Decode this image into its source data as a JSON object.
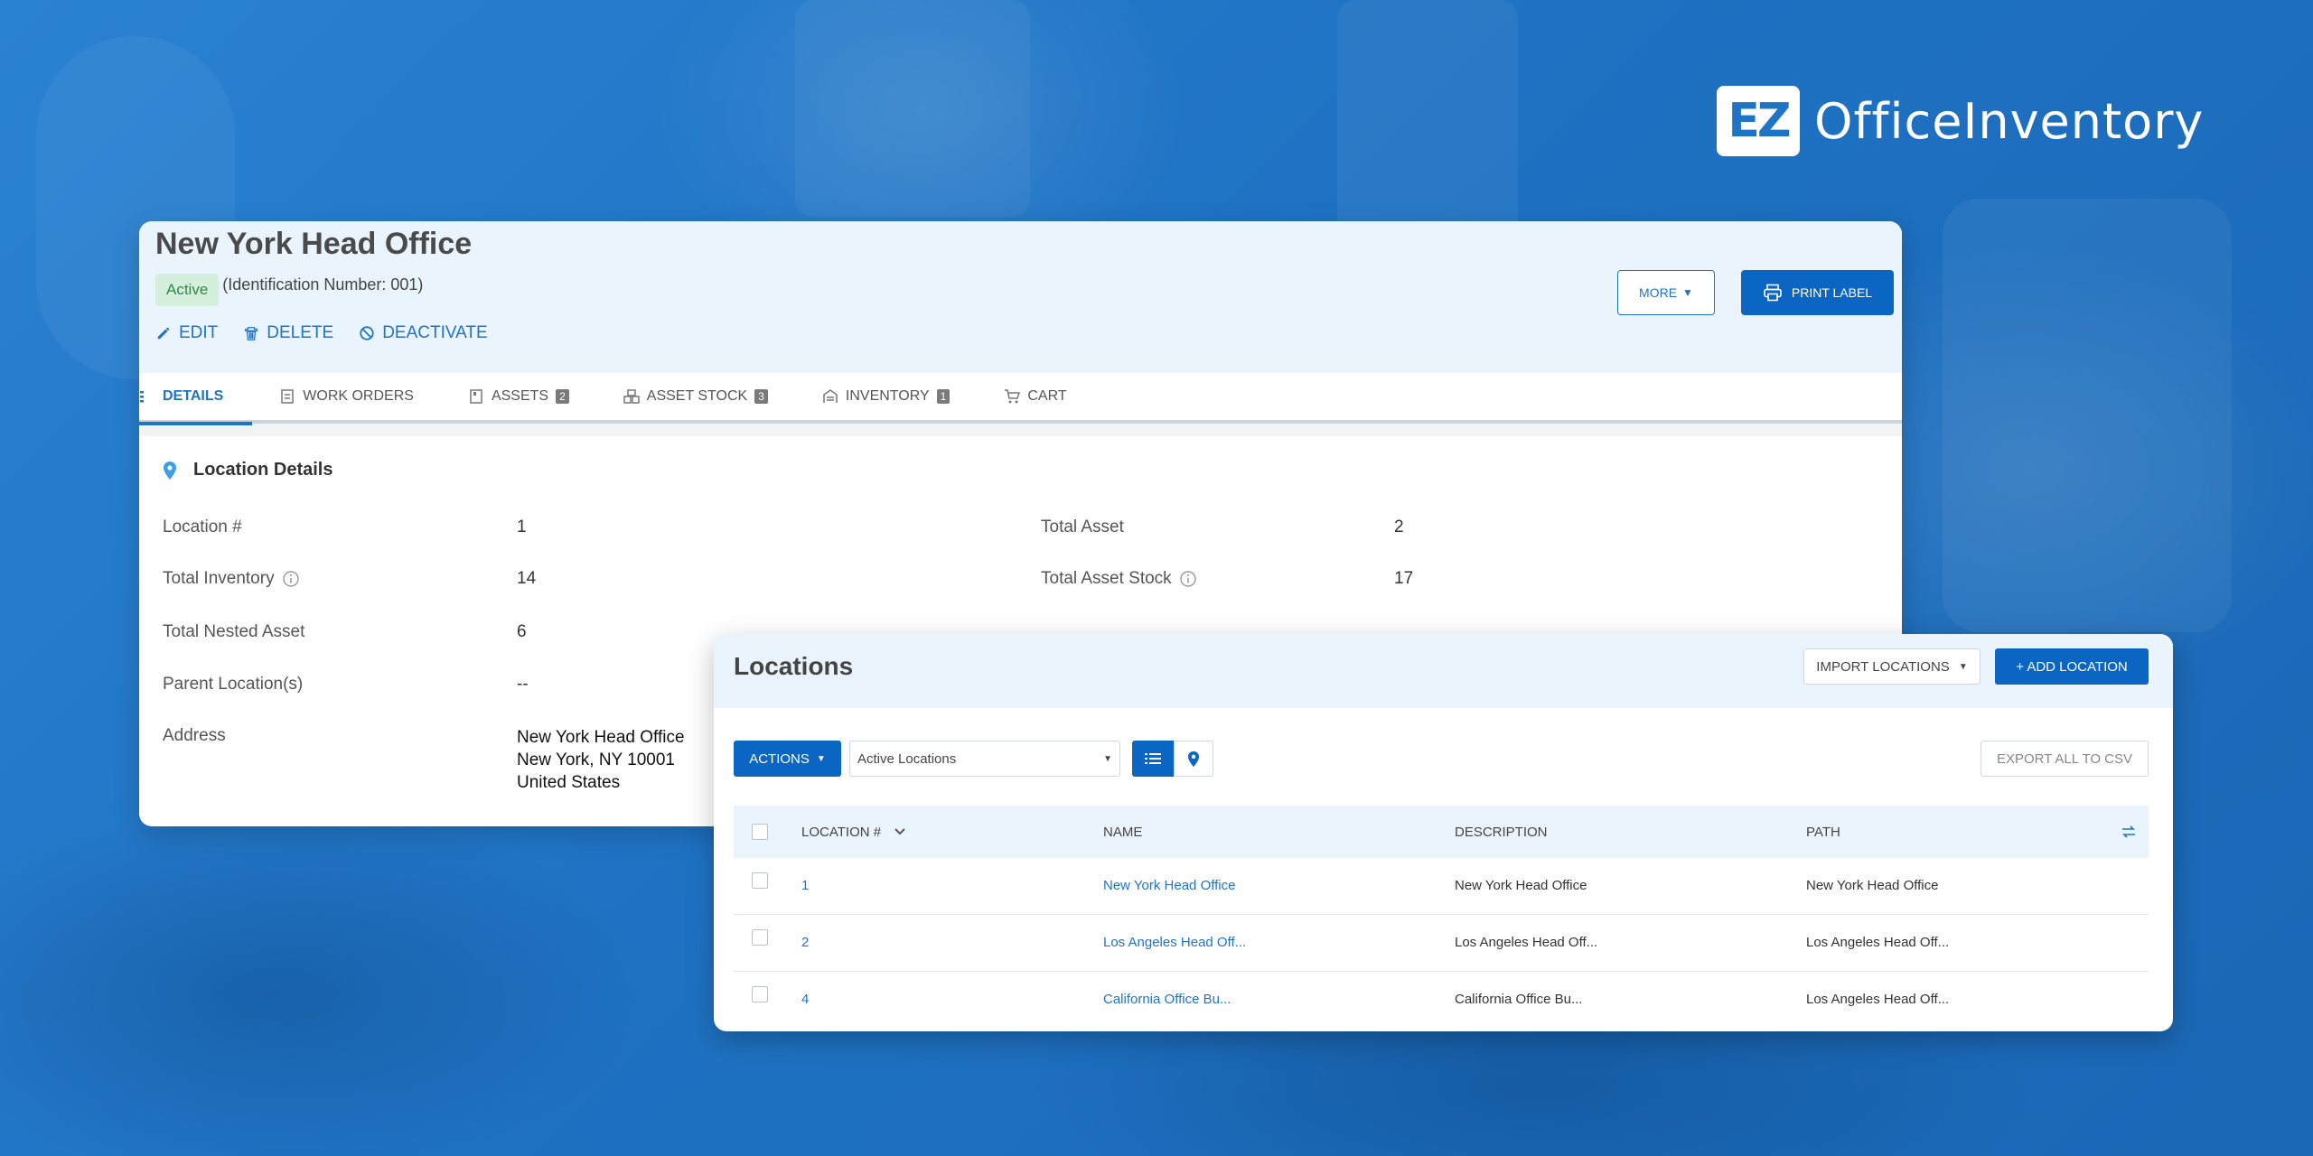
{
  "brand": {
    "logo_mark": "EZ",
    "name": "OfficeInventory"
  },
  "detail": {
    "title": "New York Head Office",
    "status": "Active",
    "identification": "(Identification Number: 001)",
    "actions": {
      "edit": "EDIT",
      "delete": "DELETE",
      "deactivate": "DEACTIVATE"
    },
    "more_label": "MORE",
    "print_label": "PRINT LABEL",
    "tabs": [
      {
        "label": "DETAILS",
        "icon": "list-icon"
      },
      {
        "label": "WORK ORDERS",
        "icon": "clipboard-icon"
      },
      {
        "label": "ASSETS",
        "icon": "asset-icon",
        "count": "2"
      },
      {
        "label": "ASSET STOCK",
        "icon": "stock-icon",
        "count": "3"
      },
      {
        "label": "INVENTORY",
        "icon": "inventory-icon",
        "count": "1"
      },
      {
        "label": "CART",
        "icon": "cart-icon"
      }
    ],
    "section_title": "Location Details",
    "fields": {
      "location_num": {
        "label": "Location #",
        "value": "1"
      },
      "total_asset": {
        "label": "Total Asset",
        "value": "2"
      },
      "total_inventory": {
        "label": "Total Inventory",
        "value": "14"
      },
      "total_asset_stock": {
        "label": "Total Asset Stock",
        "value": "17"
      },
      "total_nested_asset": {
        "label": "Total Nested Asset",
        "value": "6"
      },
      "parent_locations": {
        "label": "Parent Location(s)",
        "value": "--"
      },
      "address": {
        "label": "Address",
        "line1": "New York Head Office",
        "line2": "New York, NY 10001",
        "line3": "United States"
      }
    }
  },
  "locations": {
    "title": "Locations",
    "import_label": "IMPORT LOCATIONS",
    "add_label": "+ ADD LOCATION",
    "actions_label": "ACTIONS",
    "filter_value": "Active Locations",
    "export_label": "EXPORT ALL TO CSV",
    "columns": {
      "location_num": "LOCATION #",
      "name": "NAME",
      "description": "DESCRIPTION",
      "path": "PATH"
    },
    "rows": [
      {
        "num": "1",
        "name": "New York Head Office",
        "description": "New York Head Office",
        "path": "New York Head Office"
      },
      {
        "num": "2",
        "name": "Los Angeles Head Off...",
        "description": "Los Angeles Head Off...",
        "path": "Los Angeles Head Off..."
      },
      {
        "num": "4",
        "name": "California Office Bu...",
        "description": "California Office Bu...",
        "path": "Los Angeles Head Off..."
      }
    ]
  },
  "colors": {
    "primary": "#0b66c3",
    "background": "#1f74c6",
    "header_tint": "#eaf4fd",
    "status_green": "#2e8a46"
  }
}
